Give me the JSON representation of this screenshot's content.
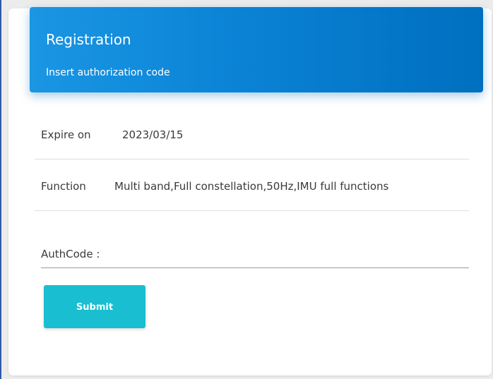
{
  "header": {
    "title": "Registration",
    "subtitle": "Insert authorization code",
    "accent_color": "#0b83d6"
  },
  "info": [
    {
      "label": "Expire on",
      "value": "2023/03/15"
    },
    {
      "label": "Function",
      "value": "Multi band,Full constellation,50Hz,IMU full functions"
    }
  ],
  "auth": {
    "label": "AuthCode :",
    "value": ""
  },
  "submit": {
    "label": "Submit",
    "color": "#19bed0"
  }
}
